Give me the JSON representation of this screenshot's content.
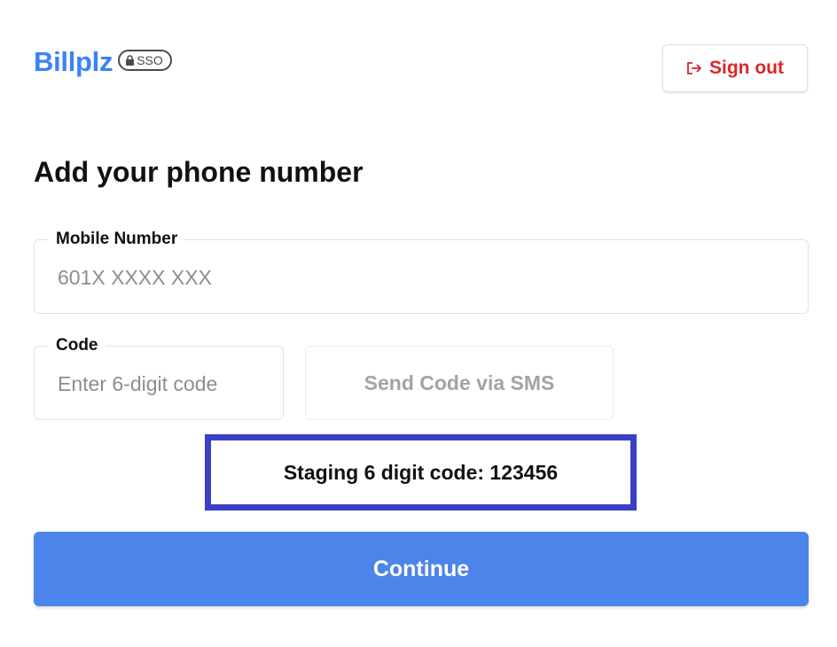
{
  "header": {
    "logo_text": "Billplz",
    "badge_text": "SSO",
    "badge_icon": "lock-icon",
    "signout_label": "Sign out",
    "signout_icon": "sign-out-icon",
    "signout_color": "#dc2626"
  },
  "main": {
    "title": "Add your phone number",
    "mobile": {
      "label": "Mobile Number",
      "value": "",
      "placeholder": "601X XXXX XXX"
    },
    "code": {
      "label": "Code",
      "value": "",
      "placeholder": "Enter 6-digit code"
    },
    "send_code_label": "Send Code via SMS",
    "staging_note": "Staging 6 digit code: 123456",
    "continue_label": "Continue"
  },
  "colors": {
    "brand": "#3b82f6",
    "primary_button": "#4d84ea",
    "highlight_border": "#3a3fc7"
  }
}
